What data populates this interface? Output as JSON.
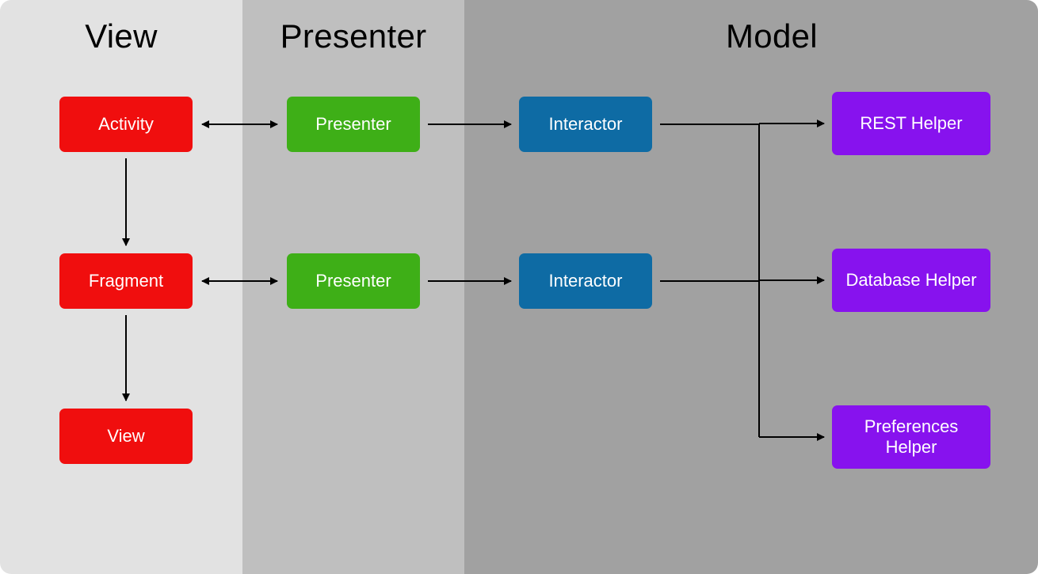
{
  "columns": {
    "view": {
      "title": "View"
    },
    "presenter": {
      "title": "Presenter"
    },
    "model": {
      "title": "Model"
    }
  },
  "nodes": {
    "activity": {
      "label": "Activity"
    },
    "fragment": {
      "label": "Fragment"
    },
    "viewNode": {
      "label": "View"
    },
    "presenter1": {
      "label": "Presenter"
    },
    "presenter2": {
      "label": "Presenter"
    },
    "interactor1": {
      "label": "Interactor"
    },
    "interactor2": {
      "label": "Interactor"
    },
    "restHelper": {
      "label": "REST Helper"
    },
    "databaseHelper": {
      "label": "Database Helper"
    },
    "preferencesHelper": {
      "label": "Preferences Helper"
    }
  },
  "colors": {
    "view": "#f00e0e",
    "presenter": "#3eaf17",
    "interactor": "#0e6ba4",
    "helper": "#8712ee",
    "bgView": "#e2e2e2",
    "bgPresenter": "#bfbfbf",
    "bgModel": "#a1a1a1"
  },
  "arrows": [
    {
      "from": "activity",
      "to": "presenter1",
      "bidirectional": true
    },
    {
      "from": "fragment",
      "to": "presenter2",
      "bidirectional": true
    },
    {
      "from": "activity",
      "to": "fragment",
      "bidirectional": false
    },
    {
      "from": "fragment",
      "to": "viewNode",
      "bidirectional": false
    },
    {
      "from": "presenter1",
      "to": "interactor1",
      "bidirectional": false
    },
    {
      "from": "presenter2",
      "to": "interactor2",
      "bidirectional": false
    },
    {
      "from": "interactor1",
      "to": "helpers-bus",
      "bidirectional": false
    },
    {
      "from": "interactor2",
      "to": "helpers-bus",
      "bidirectional": false
    },
    {
      "from": "helpers-bus",
      "to": "restHelper",
      "bidirectional": false
    },
    {
      "from": "helpers-bus",
      "to": "databaseHelper",
      "bidirectional": false
    },
    {
      "from": "helpers-bus",
      "to": "preferencesHelper",
      "bidirectional": false
    }
  ]
}
